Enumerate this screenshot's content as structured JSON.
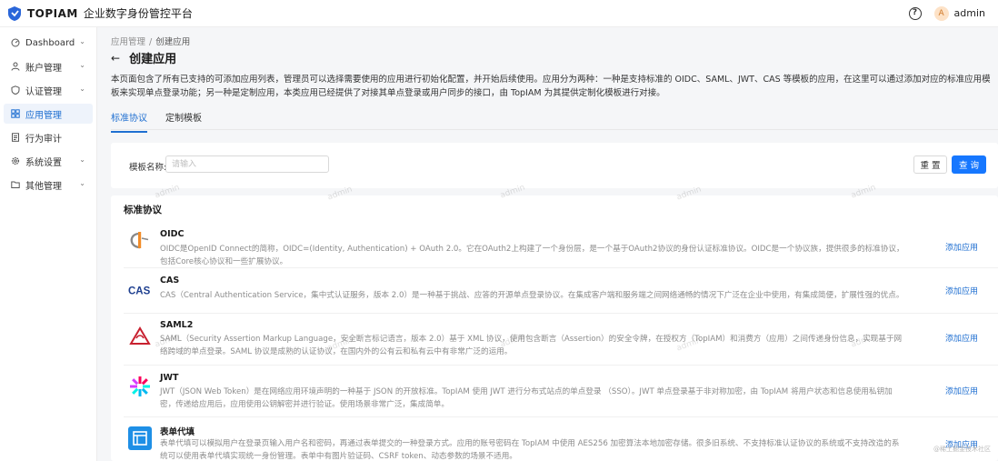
{
  "header": {
    "brand": "TOPIAM",
    "brand_name": "企业数字身份管控平台",
    "help_icon": "?",
    "avatar_initial": "A",
    "username": "admin"
  },
  "sidebar": {
    "items": [
      {
        "label": "Dashboard",
        "icon": "dashboard-icon",
        "caret": true
      },
      {
        "label": "账户管理",
        "icon": "user-icon",
        "caret": true
      },
      {
        "label": "认证管理",
        "icon": "shield-icon",
        "caret": true
      },
      {
        "label": "应用管理",
        "icon": "apps-icon",
        "caret": false,
        "active": true
      },
      {
        "label": "行为审计",
        "icon": "audit-icon",
        "caret": false
      },
      {
        "label": "系统设置",
        "icon": "gear-icon",
        "caret": true
      },
      {
        "label": "其他管理",
        "icon": "folder-icon",
        "caret": true
      }
    ]
  },
  "breadcrumb": {
    "parent": "应用管理",
    "separator": "/",
    "current": "创建应用"
  },
  "page": {
    "title": "创建应用",
    "description": "本页面包含了所有已支持的可添加应用列表，管理员可以选择需要使用的应用进行初始化配置，并开始后续使用。应用分为两种：一种是支持标准的 OIDC、SAML、JWT、CAS 等模板的应用，在这里可以通过添加对应的标准应用模板来实现单点登录功能；另一种是定制应用，本类应用已经提供了对接其单点登录或用户同步的接口，由 TopIAM 为其提供定制化模板进行对接。"
  },
  "tabs": [
    {
      "label": "标准协议",
      "active": true
    },
    {
      "label": "定制模板",
      "active": false
    }
  ],
  "search": {
    "label": "模板名称:",
    "placeholder": "请输入",
    "value": "",
    "reset_label": "重 置",
    "query_label": "查 询"
  },
  "list": {
    "title": "标准协议",
    "add_label": "添加应用",
    "apps": [
      {
        "name": "OIDC",
        "icon": "oidc-icon",
        "desc": "OIDC是OpenID Connect的简称，OIDC=(Identity, Authentication) + OAuth 2.0。它在OAuth2上构建了一个身份层，是一个基于OAuth2协议的身份认证标准协议。OIDC是一个协议族，提供很多的标准协议，包括Core核心协议和一些扩展协议。"
      },
      {
        "name": "CAS",
        "icon": "cas-icon",
        "desc": "CAS（Central Authentication Service，集中式认证服务，版本 2.0）是一种基于挑战、应答的开源单点登录协议。在集成客户端和服务端之间网络通畅的情况下广泛在企业中使用，有集成简便，扩展性强的优点。"
      },
      {
        "name": "SAML2",
        "icon": "saml-icon",
        "desc": "SAML（Security Assertion Markup Language，安全断言标记语言，版本 2.0）基于 XML 协议，使用包含断言（Assertion）的安全令牌，在授权方（TopIAM）和消费方（应用）之间传递身份信息，实现基于网络跨域的单点登录。SAML 协议是成熟的认证协议，在国内外的公有云和私有云中有非常广泛的运用。"
      },
      {
        "name": "JWT",
        "icon": "jwt-icon",
        "desc": "JWT（JSON Web Token）是在网络应用环境声明的一种基于 JSON 的开放标准。TopIAM 使用 JWT 进行分布式站点的单点登录 （SSO）。JWT 单点登录基于非对称加密，由 TopIAM 将用户状态和信息使用私钥加密，传递给应用后，应用使用公钥解密并进行验证。使用场景非常广泛，集成简单。"
      },
      {
        "name": "表单代填",
        "icon": "form-fill-icon",
        "desc": "表单代填可以模拟用户在登录页输入用户名和密码，再通过表单提交的一种登录方式。应用的账号密码在 TopIAM 中使用 AES256 加密算法本地加密存储。很多旧系统、不支持标准认证协议的系统或不支持改造的系统可以使用表单代填实现统一身份管理。表单中有图片验证码、CSRF token、动态参数的场景不适用。"
      }
    ]
  },
  "watermark": "admin",
  "footer_mark": "@稀土掘金技术社区",
  "colors": {
    "primary": "#1677ff",
    "link": "#1f6fd1",
    "active_bg": "#eef3fb"
  }
}
